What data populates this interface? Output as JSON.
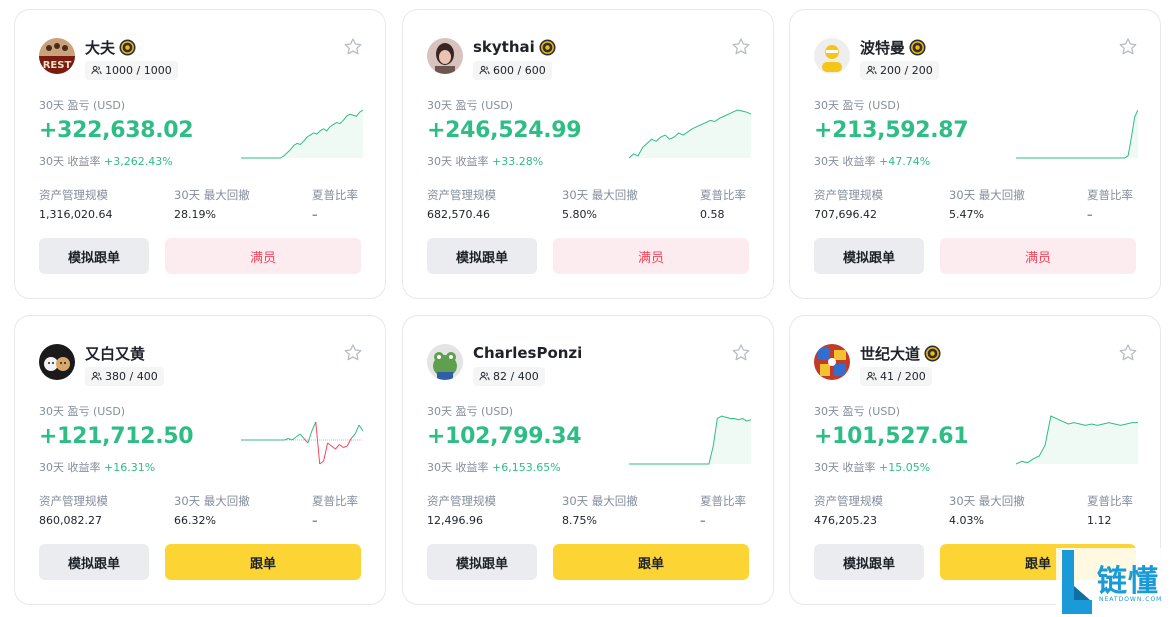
{
  "labels": {
    "pnl": "30天 盈亏 (USD)",
    "roi": "30天 收益率",
    "aum": "资产管理规模",
    "mdd": "30天 最大回撤",
    "sharpe": "夏普比率",
    "simulate": "模拟跟单",
    "full": "满员",
    "follow": "跟单"
  },
  "cards": [
    {
      "name": "大夫",
      "verified": true,
      "followers": "1000 / 1000",
      "pnl": "+322,638.02",
      "roi": "+3,262.43%",
      "aum": "1,316,020.64",
      "mdd": "28.19%",
      "sharpe": "–",
      "action": "满员",
      "avatar_icon": "bear-team-avatar"
    },
    {
      "name": "skythai",
      "verified": true,
      "followers": "600 / 600",
      "pnl": "+246,524.99",
      "roi": "+33.28%",
      "aum": "682,570.46",
      "mdd": "5.80%",
      "sharpe": "0.58",
      "action": "满员",
      "avatar_icon": "portrait-avatar"
    },
    {
      "name": "波特曼",
      "verified": true,
      "followers": "200 / 200",
      "pnl": "+213,592.87",
      "roi": "+47.74%",
      "aum": "707,696.42",
      "mdd": "5.47%",
      "sharpe": "–",
      "action": "满员",
      "avatar_icon": "yellow-user-avatar"
    },
    {
      "name": "又白又黄",
      "verified": false,
      "followers": "380 / 400",
      "pnl": "+121,712.50",
      "roi": "+16.31%",
      "aum": "860,082.27",
      "mdd": "66.32%",
      "sharpe": "–",
      "action": "跟单",
      "avatar_icon": "cats-avatar"
    },
    {
      "name": "CharlesPonzi",
      "verified": false,
      "followers": "82 / 400",
      "pnl": "+102,799.34",
      "roi": "+6,153.65%",
      "aum": "12,496.96",
      "mdd": "8.75%",
      "sharpe": "–",
      "action": "跟单",
      "avatar_icon": "frog-avatar"
    },
    {
      "name": "世纪大道",
      "verified": true,
      "followers": "41 / 200",
      "pnl": "+101,527.61",
      "roi": "+15.05%",
      "aum": "476,205.23",
      "mdd": "4.03%",
      "sharpe": "1.12",
      "action": "跟单",
      "avatar_icon": "cartoon-avatar"
    }
  ],
  "sparklines": [
    {
      "up": [
        0,
        0,
        0,
        0,
        0,
        0,
        0,
        0,
        0,
        0,
        0,
        0,
        0,
        2,
        5,
        8,
        12,
        14,
        13,
        16,
        20,
        22,
        24,
        23,
        26,
        28,
        26,
        30,
        32,
        34,
        33,
        36,
        40,
        42,
        41,
        40,
        44,
        46
      ]
    },
    {
      "up": [
        0,
        4,
        2,
        10,
        14,
        18,
        16,
        20,
        22,
        18,
        20,
        24,
        22,
        25,
        28,
        30,
        32,
        34,
        36,
        35,
        38,
        40,
        42,
        44,
        46,
        45,
        44,
        42
      ]
    },
    {
      "up": [
        0,
        0,
        0,
        0,
        0,
        0,
        0,
        0,
        0,
        0,
        0,
        0,
        0,
        0,
        0,
        0,
        0,
        0,
        0,
        0,
        0,
        0,
        0,
        0,
        0,
        0,
        0,
        0,
        0,
        0,
        0,
        0,
        0,
        0,
        2,
        18,
        36,
        42
      ]
    },
    {
      "values": [
        0,
        0,
        0,
        0,
        0,
        0,
        0,
        0,
        0,
        0,
        0,
        0,
        1,
        0,
        2,
        4,
        1,
        -2,
        6,
        12,
        -16,
        -14,
        -2,
        -4,
        -6,
        -3,
        -5,
        -4,
        1,
        4,
        10,
        6
      ]
    },
    {
      "up": [
        0,
        0,
        0,
        0,
        0,
        0,
        0,
        0,
        0,
        0,
        0,
        0,
        0,
        0,
        0,
        0,
        0,
        0,
        0,
        0,
        14,
        36,
        38,
        37,
        36,
        36,
        35,
        36,
        34,
        35
      ]
    },
    {
      "up": [
        0,
        2,
        1,
        4,
        6,
        14,
        36,
        34,
        32,
        30,
        31,
        30,
        29,
        30,
        29,
        30,
        31,
        30,
        29,
        30,
        31,
        31
      ]
    }
  ],
  "colors": {
    "up": "#2ebd85",
    "down": "#f6465d",
    "accent": "#fcd535"
  },
  "watermark": {
    "text": "链懂",
    "sub": "NEATDOWN.COM"
  }
}
